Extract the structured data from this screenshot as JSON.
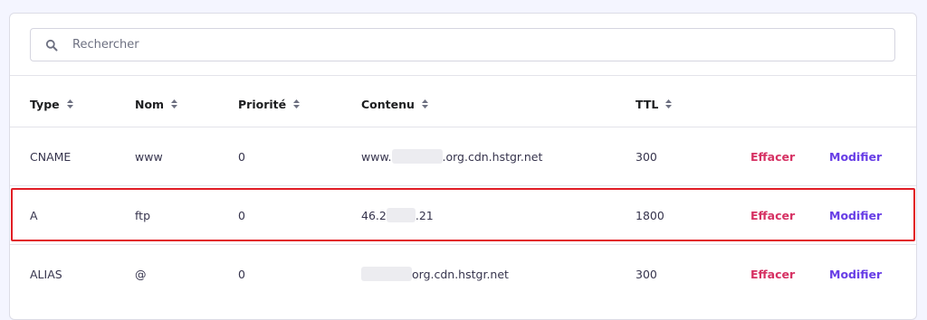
{
  "search": {
    "placeholder": "Rechercher"
  },
  "columns": {
    "type": "Type",
    "nom": "Nom",
    "priorite": "Priorité",
    "contenu": "Contenu",
    "ttl": "TTL"
  },
  "records": [
    {
      "type": "CNAME",
      "nom": "www",
      "priorite": "0",
      "contenu_prefix": "www.",
      "contenu_suffix": ".org.cdn.hstgr.net",
      "ttl": "300",
      "delete": "Effacer",
      "edit": "Modifier"
    },
    {
      "type": "A",
      "nom": "ftp",
      "priorite": "0",
      "contenu_prefix": "46.2",
      "contenu_suffix": ".21",
      "ttl": "1800",
      "delete": "Effacer",
      "edit": "Modifier"
    },
    {
      "type": "ALIAS",
      "nom": "@",
      "priorite": "0",
      "contenu_prefix": "",
      "contenu_suffix": "org.cdn.hstgr.net",
      "ttl": "300",
      "delete": "Effacer",
      "edit": "Modifier"
    }
  ],
  "colors": {
    "delete": "#d63163",
    "edit": "#673de6",
    "highlight": "#e11d25"
  }
}
